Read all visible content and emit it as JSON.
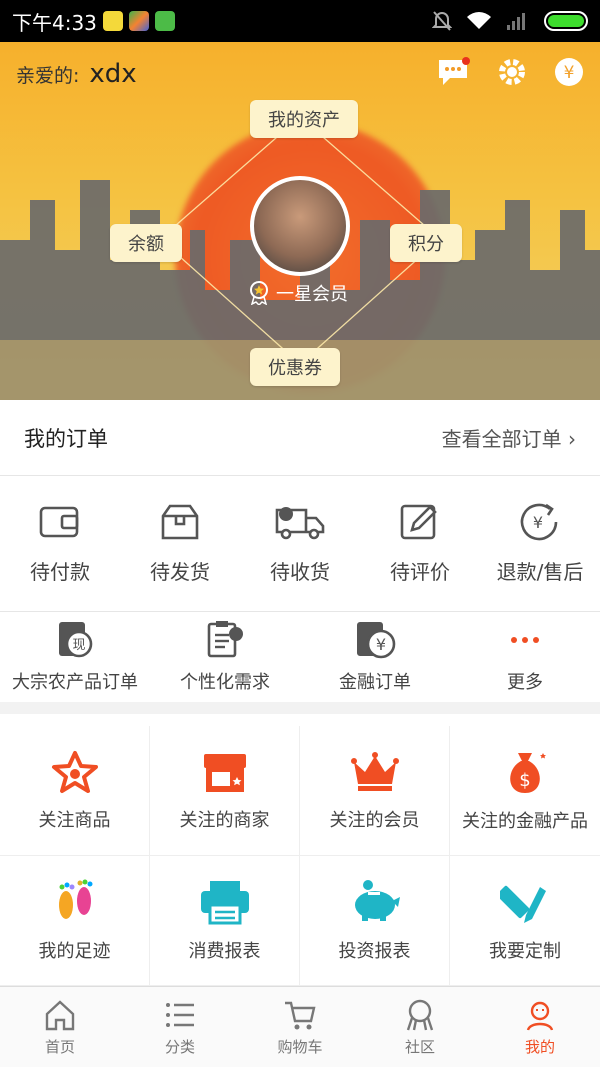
{
  "status_bar": {
    "time": "下午4:33"
  },
  "header": {
    "greeting": "亲爱的:",
    "username": "xdx",
    "icons": [
      "message-icon",
      "gear-icon",
      "yuan-icon"
    ]
  },
  "profile": {
    "tags": {
      "assets": "我的资产",
      "balance": "余额",
      "points": "积分",
      "coupons": "优惠券"
    },
    "member_level": "一星会员"
  },
  "orders": {
    "title": "我的订单",
    "view_all": "查看全部订单 ›",
    "statuses": [
      {
        "label": "待付款",
        "icon": "wallet-icon"
      },
      {
        "label": "待发货",
        "icon": "box-icon"
      },
      {
        "label": "待收货",
        "icon": "truck-icon"
      },
      {
        "label": "待评价",
        "icon": "edit-icon"
      },
      {
        "label": "退款/售后",
        "icon": "refund-icon"
      }
    ],
    "extra": [
      {
        "label": "大宗农产品订单",
        "icon": "cash-doc-icon"
      },
      {
        "label": "个性化需求",
        "icon": "checklist-icon"
      },
      {
        "label": "金融订单",
        "icon": "finance-doc-icon"
      },
      {
        "label": "更多",
        "icon": "more-icon"
      }
    ]
  },
  "grid": [
    {
      "label": "关注商品",
      "icon": "star-icon"
    },
    {
      "label": "关注的商家",
      "icon": "shop-icon"
    },
    {
      "label": "关注的会员",
      "icon": "crown-icon"
    },
    {
      "label": "关注的金融产品",
      "icon": "money-bag-icon"
    },
    {
      "label": "我的足迹",
      "icon": "footprint-icon"
    },
    {
      "label": "消费报表",
      "icon": "printer-icon"
    },
    {
      "label": "投资报表",
      "icon": "piggy-bank-icon"
    },
    {
      "label": "我要定制",
      "icon": "pencil-ruler-icon"
    }
  ],
  "tabbar": [
    {
      "label": "首页",
      "icon": "home-icon"
    },
    {
      "label": "分类",
      "icon": "list-icon"
    },
    {
      "label": "购物车",
      "icon": "cart-icon"
    },
    {
      "label": "社区",
      "icon": "community-icon"
    },
    {
      "label": "我的",
      "icon": "user-icon",
      "active": true
    }
  ],
  "colors": {
    "accent": "#f04e23",
    "hero_yellow": "#f5c342",
    "sun": "#ee5a24",
    "tag_bg": "#fdf3cc"
  }
}
